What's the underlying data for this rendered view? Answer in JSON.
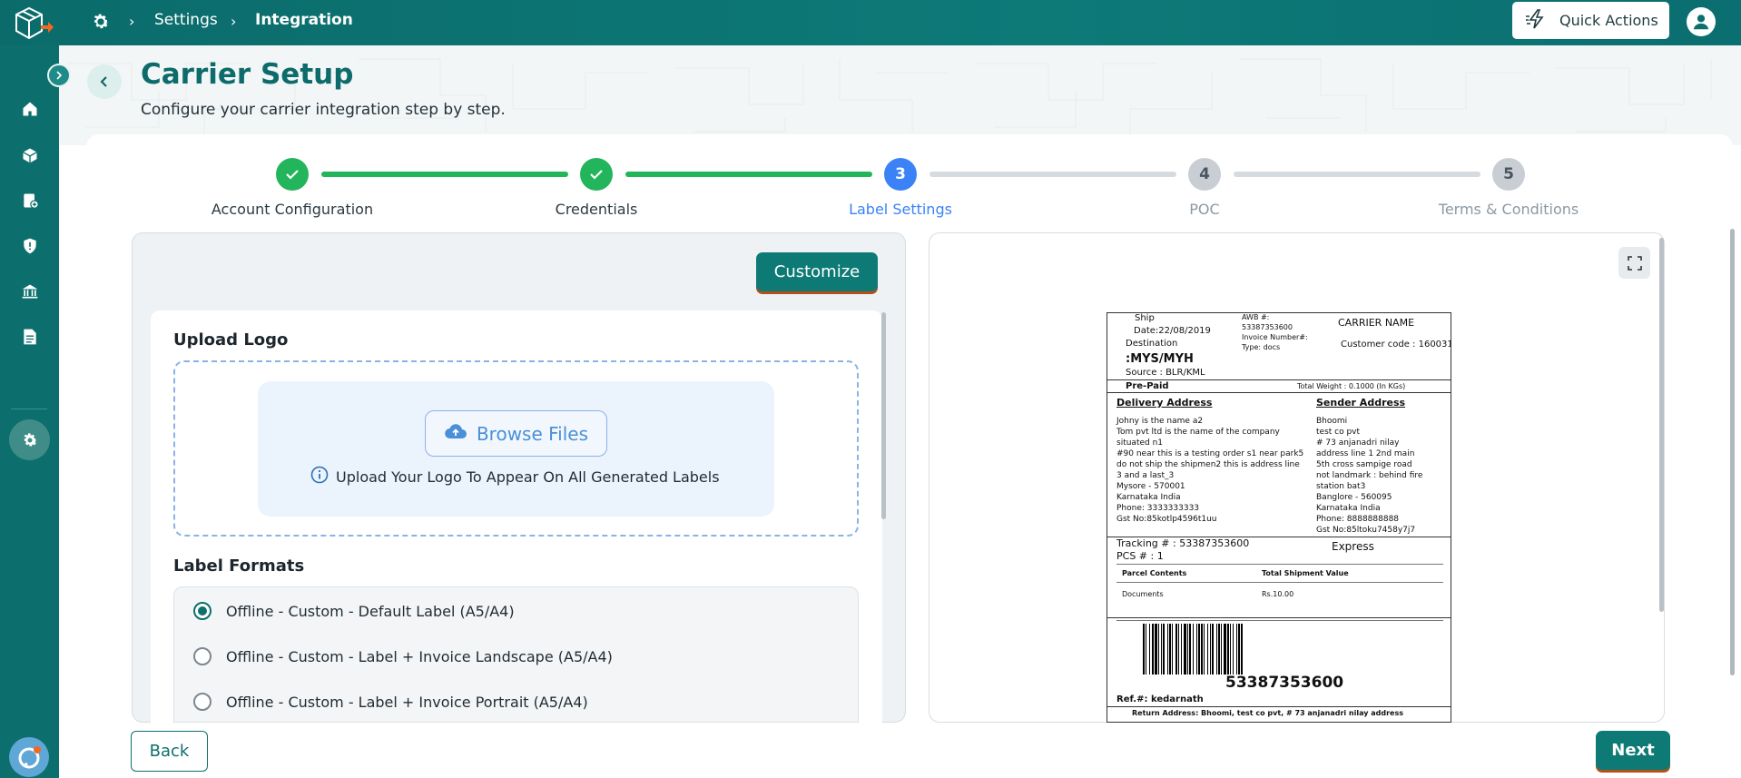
{
  "breadcrumb": {
    "settings": "Settings",
    "current": "Integration"
  },
  "topbar": {
    "quick_actions": "Quick Actions"
  },
  "header": {
    "title": "Carrier Setup",
    "subtitle": "Configure your carrier integration step by step."
  },
  "stepper": {
    "steps": [
      {
        "label": "Account Configuration",
        "state": "done",
        "number": "1"
      },
      {
        "label": "Credentials",
        "state": "done",
        "number": "2"
      },
      {
        "label": "Label Settings",
        "state": "active",
        "number": "3"
      },
      {
        "label": "POC",
        "state": "todo",
        "number": "4"
      },
      {
        "label": "Terms & Conditions",
        "state": "todo",
        "number": "5"
      }
    ]
  },
  "left": {
    "customize": "Customize",
    "upload_title": "Upload Logo",
    "browse": "Browse Files",
    "upload_note": "Upload Your Logo To Appear On All Generated Labels",
    "formats_title": "Label Formats",
    "formats": [
      {
        "label": "Offline - Custom - Default Label (A5/A4)",
        "selected": true
      },
      {
        "label": "Offline - Custom - Label + Invoice Landscape (A5/A4)",
        "selected": false
      },
      {
        "label": "Offline - Custom - Label + Invoice Portrait (A5/A4)",
        "selected": false
      }
    ]
  },
  "label": {
    "ship": "Ship",
    "ship_date": "Date:22/08/2019",
    "destination": "Destination",
    "dest_code": ":MYS/MYH",
    "source": "Source : BLR/KML",
    "awb_label": "AWB #:",
    "awb": "53387353600",
    "invoice": "Invoice Number#:",
    "type": "Type: docs",
    "carrier": "CARRIER NAME",
    "customer_code": "Customer code : 160031",
    "prepaid": "Pre-Paid",
    "weight": "Total Weight : 0.1000 (In KGs)",
    "delivery_title": "Delivery Address",
    "delivery_lines": [
      "Johny is the name a2",
      "Tom pvt ltd is the name of the company",
      "situated n1",
      "#90 near this is a testing order s1 near park5",
      "do not ship the shipmen2 this is address line",
      "3 and a last_3",
      "Mysore - 570001",
      "Karnataka India",
      "Phone: 3333333333",
      "Gst No:85kotlp4596t1uu"
    ],
    "sender_title": "Sender Address",
    "sender_lines": [
      "Bhoomi",
      "test co pvt",
      "# 73 anjanadri nilay",
      "address line 1 2nd main",
      "5th cross sampige road",
      "not landmark : behind fire",
      "station bat3",
      "Banglore - 560095",
      "Karnataka India",
      "Phone: 8888888888",
      "Gst No:85ltoku7458y7j7"
    ],
    "tracking": "Tracking # : 53387353600",
    "pcs": "PCS # : 1",
    "service": "Express",
    "contents_h": "Parcel Contents",
    "value_h": "Total Shipment Value",
    "contents": "Documents",
    "value": "Rs.10.00",
    "barcode_text": "53387353600",
    "ref": "Ref.#: kedarnath",
    "return": "Return Address: Bhoomi, test co pvt, # 73 anjanadri nilay address"
  },
  "footer": {
    "back": "Back",
    "next": "Next"
  },
  "colors": {
    "primary": "#0e7a76",
    "done": "#22b55b",
    "active": "#3b82f6",
    "accent": "#b25018"
  }
}
